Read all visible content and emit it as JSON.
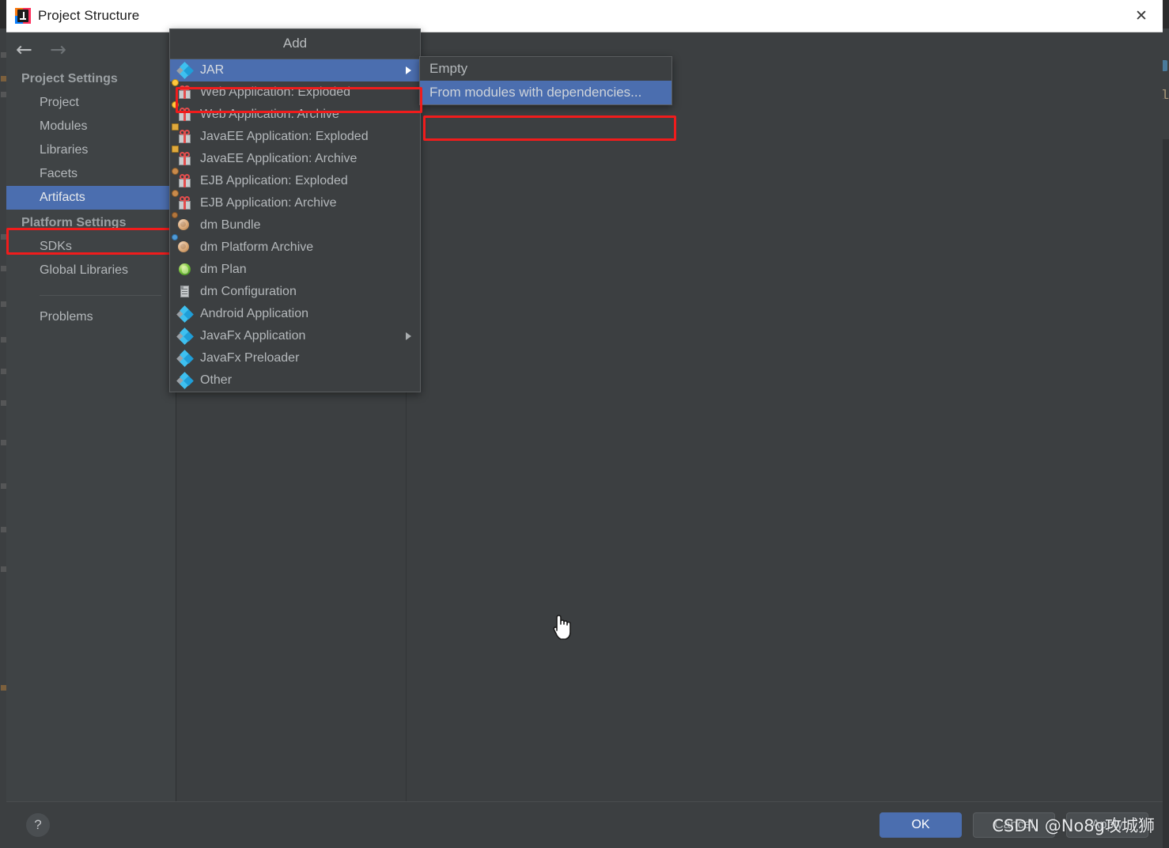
{
  "window": {
    "title": "Project Structure",
    "app_icon": "intellij-idea-icon",
    "close_label": "✕"
  },
  "nav": {
    "back_icon": "arrow-left-icon",
    "forward_icon": "arrow-right-icon",
    "back_label": "←",
    "forward_label": "→"
  },
  "sidebar": {
    "groups": [
      {
        "label": "Project Settings",
        "items": [
          {
            "label": "Project",
            "selected": false
          },
          {
            "label": "Modules",
            "selected": false
          },
          {
            "label": "Libraries",
            "selected": false
          },
          {
            "label": "Facets",
            "selected": false
          },
          {
            "label": "Artifacts",
            "selected": true
          }
        ]
      },
      {
        "label": "Platform Settings",
        "items": [
          {
            "label": "SDKs",
            "selected": false
          },
          {
            "label": "Global Libraries",
            "selected": false
          }
        ]
      }
    ],
    "problems_label": "Problems"
  },
  "toolbar": {
    "add_label": "+",
    "remove_label": "−",
    "copy_icon": "copy-icon"
  },
  "add_menu": {
    "header": "Add",
    "items": [
      {
        "label": "JAR",
        "icon": "jar-icon",
        "selected": true,
        "submenu": true
      },
      {
        "label": "Web Application: Exploded",
        "icon": "gift-globe-icon",
        "selected": false,
        "submenu": false
      },
      {
        "label": "Web Application: Archive",
        "icon": "gift-globe-icon",
        "selected": false,
        "submenu": false
      },
      {
        "label": "JavaEE Application: Exploded",
        "icon": "gift-grid-icon",
        "selected": false,
        "submenu": false
      },
      {
        "label": "JavaEE Application: Archive",
        "icon": "gift-grid-icon",
        "selected": false,
        "submenu": false
      },
      {
        "label": "EJB Application: Exploded",
        "icon": "gift-bean-icon",
        "selected": false,
        "submenu": false
      },
      {
        "label": "EJB Application: Archive",
        "icon": "gift-bean-icon",
        "selected": false,
        "submenu": false
      },
      {
        "label": "dm Bundle",
        "icon": "dm-bundle-icon",
        "selected": false,
        "submenu": false
      },
      {
        "label": "dm Platform Archive",
        "icon": "dm-platform-icon",
        "selected": false,
        "submenu": false
      },
      {
        "label": "dm Plan",
        "icon": "dm-plan-icon",
        "selected": false,
        "submenu": false
      },
      {
        "label": "dm Configuration",
        "icon": "dm-configuration-icon",
        "selected": false,
        "submenu": false
      },
      {
        "label": "Android Application",
        "icon": "jar-icon",
        "selected": false,
        "submenu": false
      },
      {
        "label": "JavaFx Application",
        "icon": "jar-icon",
        "selected": false,
        "submenu": true
      },
      {
        "label": "JavaFx Preloader",
        "icon": "jar-icon",
        "selected": false,
        "submenu": false
      },
      {
        "label": "Other",
        "icon": "jar-icon",
        "selected": false,
        "submenu": false
      }
    ]
  },
  "jar_submenu": {
    "items": [
      {
        "label": "Empty",
        "selected": false
      },
      {
        "label": "From modules with dependencies...",
        "selected": true
      }
    ]
  },
  "footer": {
    "help_label": "?",
    "ok_label": "OK",
    "cancel_label": "Cancel",
    "apply_label": "Apply"
  },
  "watermark": {
    "text": "CSDN @No8g攻城狮"
  },
  "background": {
    "right_text": "ol"
  },
  "colors": {
    "dialog_bg": "#3c3f41",
    "sidebar_bg": "#3f4345",
    "selection_blue": "#4b6eaf",
    "annotation_red": "#f01c1c",
    "titlebar_bg": "#ffffff",
    "text_primary": "#b4b8bb"
  }
}
